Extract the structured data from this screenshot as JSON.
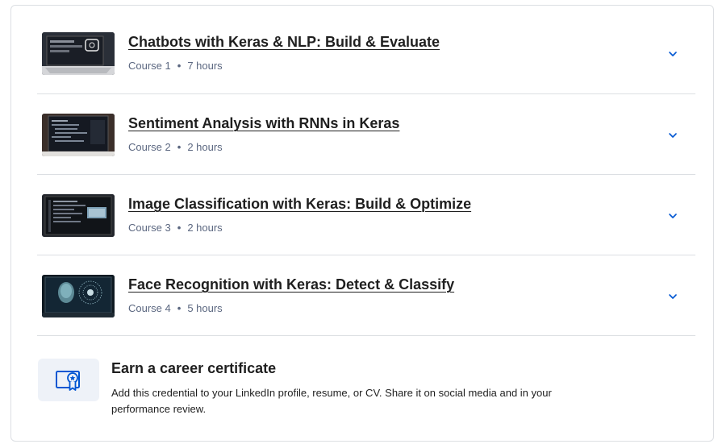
{
  "courses": [
    {
      "title": "Chatbots with Keras & NLP: Build & Evaluate",
      "course": "Course 1",
      "duration": "7 hours"
    },
    {
      "title": "Sentiment Analysis with RNNs in Keras",
      "course": "Course 2",
      "duration": "2 hours"
    },
    {
      "title": "Image Classification with Keras: Build & Optimize",
      "course": "Course 3",
      "duration": "2 hours"
    },
    {
      "title": "Face Recognition with Keras: Detect & Classify",
      "course": "Course 4",
      "duration": "5 hours"
    }
  ],
  "certificate": {
    "title": "Earn a career certificate",
    "description": "Add this credential to your LinkedIn profile, resume, or CV. Share it on social media and in your performance review."
  },
  "colors": {
    "accent": "#0056d2",
    "border": "#dcdfe3",
    "meta_text": "#5b6780",
    "icon_bg": "#eef2f8"
  },
  "icons": {
    "expand": "chevron-down-icon",
    "certificate": "certificate-icon"
  }
}
